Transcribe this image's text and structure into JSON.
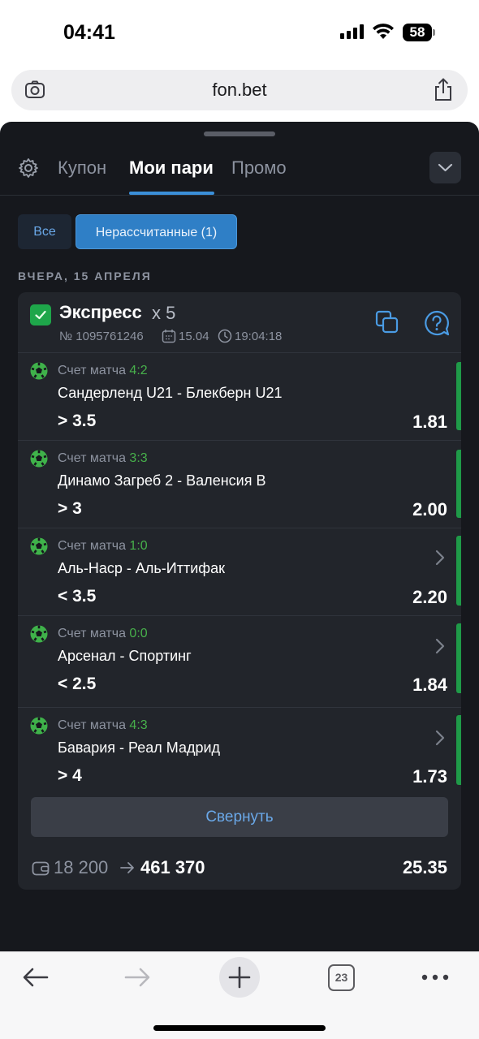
{
  "status_bar": {
    "time": "04:41",
    "battery": "58"
  },
  "browser": {
    "url": "fon.bet",
    "open_tabs": "23"
  },
  "tabs": [
    {
      "label": "Купон"
    },
    {
      "label": "Мои пари",
      "active": true
    },
    {
      "label": "Промо"
    }
  ],
  "filters": {
    "all": "Все",
    "unsettled": "Нерассчитанные (1)"
  },
  "date_header": "ВЧЕРА, 15 АПРЕЛЯ",
  "bet": {
    "type": "Экспресс",
    "multiplier": "x 5",
    "number": "№ 1095761246",
    "date": "15.04",
    "time": "19:04:18",
    "events": [
      {
        "score_label": "Счет матча",
        "score": "4:2",
        "match": "Сандерленд U21 - Блекберн U21",
        "pick": "> 3.5",
        "odd": "1.81",
        "has_arrow": false
      },
      {
        "score_label": "Счет матча",
        "score": "3:3",
        "match": "Динамо Загреб 2 - Валенсия В",
        "pick": "> 3",
        "odd": "2.00",
        "has_arrow": false
      },
      {
        "score_label": "Счет матча",
        "score": "1:0",
        "match": "Аль-Наср - Аль-Иттифак",
        "pick": "< 3.5",
        "odd": "2.20",
        "has_arrow": true
      },
      {
        "score_label": "Счет матча",
        "score": "0:0",
        "match": "Арсенал - Спортинг",
        "pick": "< 2.5",
        "odd": "1.84",
        "has_arrow": true
      },
      {
        "score_label": "Счет матча",
        "score": "4:3",
        "match": "Бавария - Реал Мадрид",
        "pick": "> 4",
        "odd": "1.73",
        "has_arrow": true
      }
    ],
    "collapse_label": "Свернуть",
    "stake": "18 200",
    "payout": "461 370",
    "total_odd": "25.35"
  },
  "colors": {
    "accent": "#2f7fc6",
    "win_green": "#1f9a48",
    "score_green": "#47b04b",
    "sheet_bg": "#16181d",
    "card_bg": "#22252b"
  },
  "icons": [
    "camera-icon",
    "share-icon",
    "settings-icon",
    "chevron-down-icon",
    "checkbox-icon",
    "calendar-icon",
    "clock-icon",
    "copy-icon",
    "help-icon",
    "soccer-ball-icon",
    "chevron-right-icon",
    "wallet-icon",
    "arrow-right-icon",
    "back-icon",
    "forward-icon",
    "plus-icon",
    "tabs-icon",
    "more-icon"
  ]
}
